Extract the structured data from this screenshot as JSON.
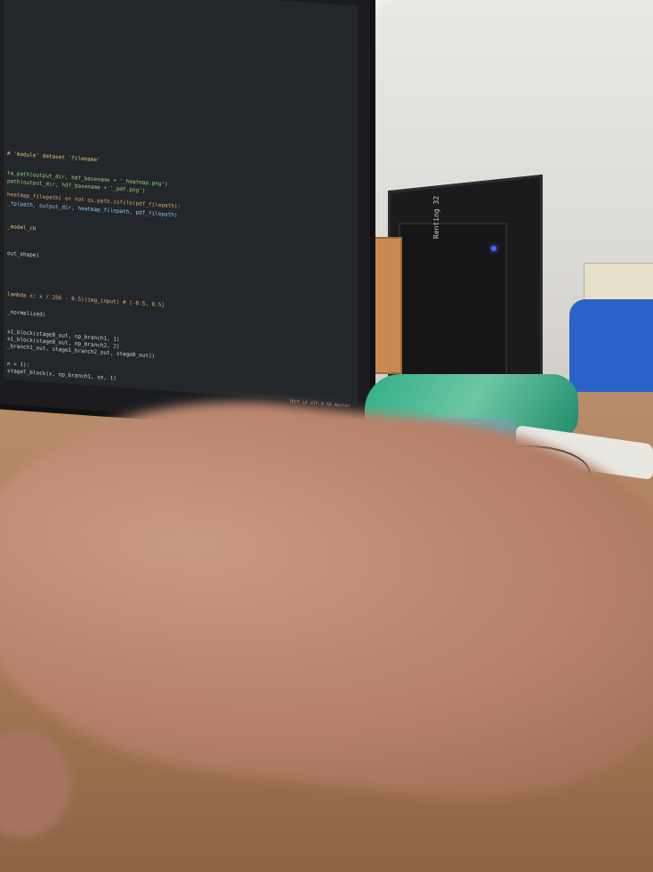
{
  "scene": {
    "monitor": {
      "code_lines": [
        "# 'module' dataset 'filename'",
        "ta_path(output_dir, hdf_basename + '_heatmap.png')",
        "path(output_dir, hdf_basename + '_pdf.png')",
        "heatmap_filepath) or not os.path.isfile(pdf_filepath):",
        "_fp(path, output_dir, heatmap_filepath, pdf_filepath)",
        "_model_cb",
        "out_shape)",
        "lambda x: x / 256 - 0.5)(img_input)  # [-0.5, 0.5]",
        "_normalized)",
        "s1_block(stage0_out, np_branch1, 1)",
        "s1_block(stage0_out, np_branch2, 2)",
        "_branch1_out, stage1_branch2_out, stage0_out])",
        "n = 1):",
        "stageT_block(x, np_branch1, sn, 1)"
      ],
      "status_text": "TEXT  LF  UTF-8  GO master"
    },
    "pc_label": "Renting 32"
  }
}
